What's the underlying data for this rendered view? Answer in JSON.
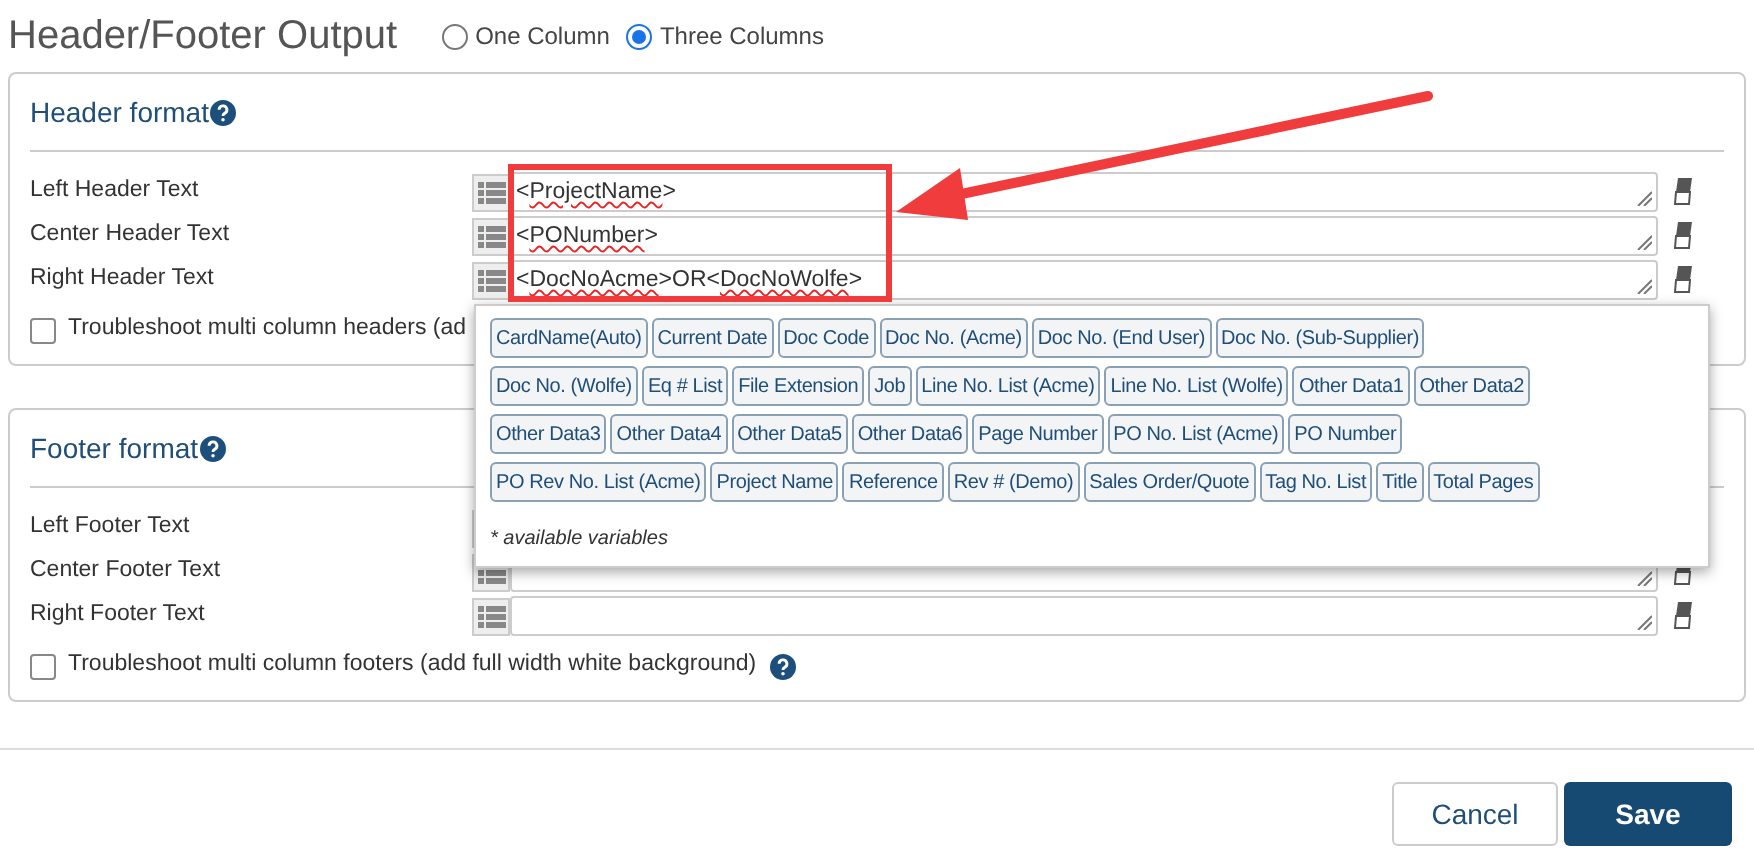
{
  "title": "Header/Footer Output",
  "layout_options": [
    {
      "label": "One Column",
      "selected": false
    },
    {
      "label": "Three Columns",
      "selected": true
    }
  ],
  "header": {
    "title": "Header format",
    "rows": [
      {
        "label": "Left Header Text",
        "value": "<ProjectName>"
      },
      {
        "label": "Center Header Text",
        "value": "<PONumber>"
      },
      {
        "label": "Right Header Text",
        "value": "<DocNoAcme>OR<DocNoWolfe>"
      }
    ],
    "checkbox": {
      "label": "Troubleshoot multi column headers (ad",
      "checked": false
    }
  },
  "footer": {
    "title": "Footer format",
    "rows": [
      {
        "label": "Left Footer Text",
        "value": ""
      },
      {
        "label": "Center Footer Text",
        "value": ""
      },
      {
        "label": "Right Footer Text",
        "value": ""
      }
    ],
    "checkbox": {
      "label": "Troubleshoot multi column footers (add full width white background)",
      "checked": false
    }
  },
  "variables_popup": {
    "chips": [
      "CardName(Auto)",
      "Current Date",
      "Doc Code",
      "Doc No. (Acme)",
      "Doc No. (End User)",
      "Doc No. (Sub-Supplier)",
      "Doc No. (Wolfe)",
      "Eq # List",
      "File Extension",
      "Job",
      "Line No. List (Acme)",
      "Line No. List (Wolfe)",
      "Other Data1",
      "Other Data2",
      "Other Data3",
      "Other Data4",
      "Other Data5",
      "Other Data6",
      "Page Number",
      "PO No. List (Acme)",
      "PO Number",
      "PO Rev No. List (Acme)",
      "Project Name",
      "Reference",
      "Rev # (Demo)",
      "Sales Order/Quote",
      "Tag No. List",
      "Title",
      "Total Pages"
    ],
    "note": "* available variables"
  },
  "buttons": [
    "Cancel",
    "Save"
  ]
}
